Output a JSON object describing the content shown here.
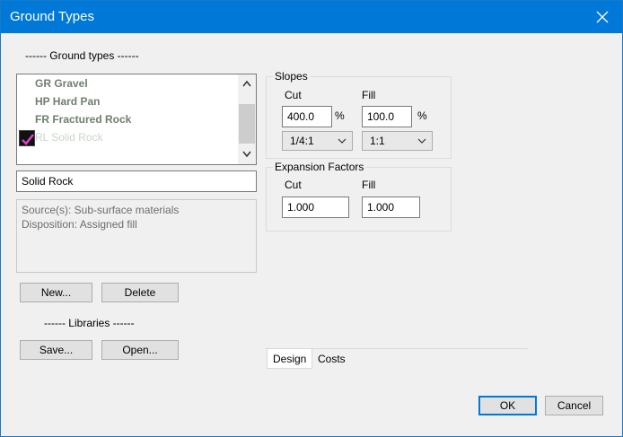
{
  "window": {
    "title": "Ground Types"
  },
  "ground_types": {
    "header": "------ Ground types ------",
    "items": [
      {
        "label": "GR Gravel"
      },
      {
        "label": "HP Hard Pan"
      },
      {
        "label": "FR Fractured Rock"
      },
      {
        "label": "RL Solid Rock",
        "checked": true
      }
    ],
    "name_value": "Solid Rock",
    "source_text": "Source(s): Sub-surface materials",
    "disposition_text": "Disposition: Assigned fill"
  },
  "buttons": {
    "new_label": "New...",
    "delete_label": "Delete",
    "save_label": "Save...",
    "open_label": "Open...",
    "ok_label": "OK",
    "cancel_label": "Cancel"
  },
  "libraries": {
    "header": "------  Libraries ------"
  },
  "slopes": {
    "group_label": "Slopes",
    "cut_label": "Cut",
    "fill_label": "Fill",
    "cut_value": "400.0",
    "fill_value": "100.0",
    "percent_symbol": "%",
    "cut_ratio": "1/4:1",
    "fill_ratio": "1:1"
  },
  "expansion": {
    "group_label": "Expansion Factors",
    "cut_label": "Cut",
    "fill_label": "Fill",
    "cut_value": "1.000",
    "fill_value": "1.000"
  },
  "tabs": [
    {
      "label": "Design",
      "active": true
    },
    {
      "label": "Costs",
      "active": false
    }
  ],
  "colors": {
    "title_bar": "#0078d7",
    "accent": "#0078d7",
    "checkmark": "#e040c8",
    "list_text": "#6f7f6f"
  }
}
